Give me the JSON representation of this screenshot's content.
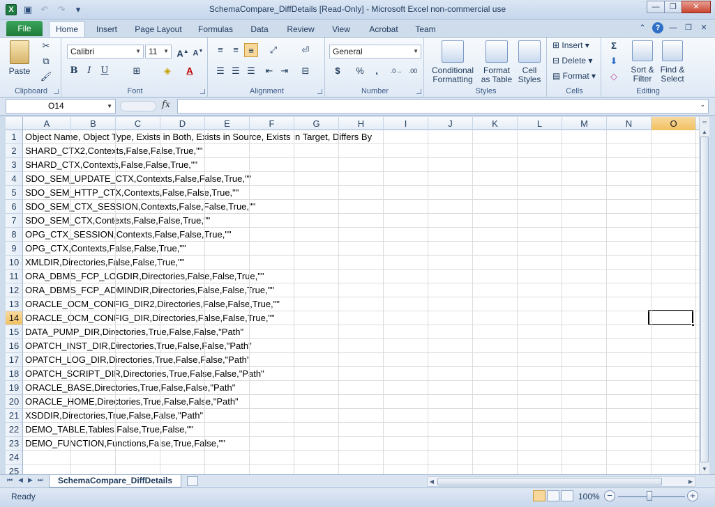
{
  "window": {
    "title": "SchemaCompare_DiffDetails  [Read-Only]  -  Microsoft Excel non-commercial use",
    "app_icon": "X"
  },
  "ribbon_tabs": {
    "file": "File",
    "home": "Home",
    "insert": "Insert",
    "page_layout": "Page Layout",
    "formulas": "Formulas",
    "data": "Data",
    "review": "Review",
    "view": "View",
    "acrobat": "Acrobat",
    "team": "Team"
  },
  "ribbon": {
    "clipboard": {
      "label": "Clipboard",
      "paste": "Paste"
    },
    "font": {
      "label": "Font",
      "name": "Calibri",
      "size": "11",
      "bold": "B",
      "italic": "I",
      "underline": "U"
    },
    "alignment": {
      "label": "Alignment"
    },
    "number": {
      "label": "Number",
      "format": "General",
      "currency": "$",
      "percent": "%",
      "comma": ","
    },
    "styles": {
      "label": "Styles",
      "conditional_1": "Conditional",
      "conditional_2": "Formatting",
      "format_table_1": "Format",
      "format_table_2": "as Table",
      "cell_styles_1": "Cell",
      "cell_styles_2": "Styles"
    },
    "cells": {
      "label": "Cells",
      "insert": "Insert",
      "delete": "Delete",
      "format": "Format"
    },
    "editing": {
      "label": "Editing",
      "sort_1": "Sort &",
      "sort_2": "Filter",
      "find_1": "Find &",
      "find_2": "Select",
      "sigma": "Σ"
    }
  },
  "formula_bar": {
    "name_box": "O14",
    "fx": "fx",
    "formula": ""
  },
  "columns": [
    "A",
    "B",
    "C",
    "D",
    "E",
    "F",
    "G",
    "H",
    "I",
    "J",
    "K",
    "L",
    "M",
    "N",
    "O"
  ],
  "selected_column": "O",
  "selected_row": "14",
  "rows": [
    {
      "num": "1",
      "text": "Object Name, Object Type, Exists in Both, Exists in Source, Exists in Target, Differs By"
    },
    {
      "num": "2",
      "text": "SHARD_CTX2,Contexts,False,False,True,\"\""
    },
    {
      "num": "3",
      "text": "SHARD_CTX,Contexts,False,False,True,\"\""
    },
    {
      "num": "4",
      "text": "SDO_SEM_UPDATE_CTX,Contexts,False,False,True,\"\""
    },
    {
      "num": "5",
      "text": "SDO_SEM_HTTP_CTX,Contexts,False,False,True,\"\""
    },
    {
      "num": "6",
      "text": "SDO_SEM_CTX_SESSION,Contexts,False,False,True,\"\""
    },
    {
      "num": "7",
      "text": "SDO_SEM_CTX,Contexts,False,False,True,\"\""
    },
    {
      "num": "8",
      "text": "OPG_CTX_SESSION,Contexts,False,False,True,\"\""
    },
    {
      "num": "9",
      "text": "OPG_CTX,Contexts,False,False,True,\"\""
    },
    {
      "num": "10",
      "text": "XMLDIR,Directories,False,False,True,\"\""
    },
    {
      "num": "11",
      "text": "ORA_DBMS_FCP_LOGDIR,Directories,False,False,True,\"\""
    },
    {
      "num": "12",
      "text": "ORA_DBMS_FCP_ADMINDIR,Directories,False,False,True,\"\""
    },
    {
      "num": "13",
      "text": "ORACLE_OCM_CONFIG_DIR2,Directories,False,False,True,\"\""
    },
    {
      "num": "14",
      "text": "ORACLE_OCM_CONFIG_DIR,Directories,False,False,True,\"\""
    },
    {
      "num": "15",
      "text": "DATA_PUMP_DIR,Directories,True,False,False,\"Path\""
    },
    {
      "num": "16",
      "text": "OPATCH_INST_DIR,Directories,True,False,False,\"Path\""
    },
    {
      "num": "17",
      "text": "OPATCH_LOG_DIR,Directories,True,False,False,\"Path\""
    },
    {
      "num": "18",
      "text": "OPATCH_SCRIPT_DIR,Directories,True,False,False,\"Path\""
    },
    {
      "num": "19",
      "text": "ORACLE_BASE,Directories,True,False,False,\"Path\""
    },
    {
      "num": "20",
      "text": "ORACLE_HOME,Directories,True,False,False,\"Path\""
    },
    {
      "num": "21",
      "text": "XSDDIR,Directories,True,False,False,\"Path\""
    },
    {
      "num": "22",
      "text": "DEMO_TABLE,Tables,False,True,False,\"\""
    },
    {
      "num": "23",
      "text": "DEMO_FUNCTION,Functions,False,True,False,\"\""
    },
    {
      "num": "24",
      "text": ""
    },
    {
      "num": "25",
      "text": ""
    }
  ],
  "sheet_tab": "SchemaCompare_DiffDetails",
  "status": {
    "ready": "Ready",
    "zoom": "100%",
    "zoom_minus": "−",
    "zoom_plus": "+"
  }
}
